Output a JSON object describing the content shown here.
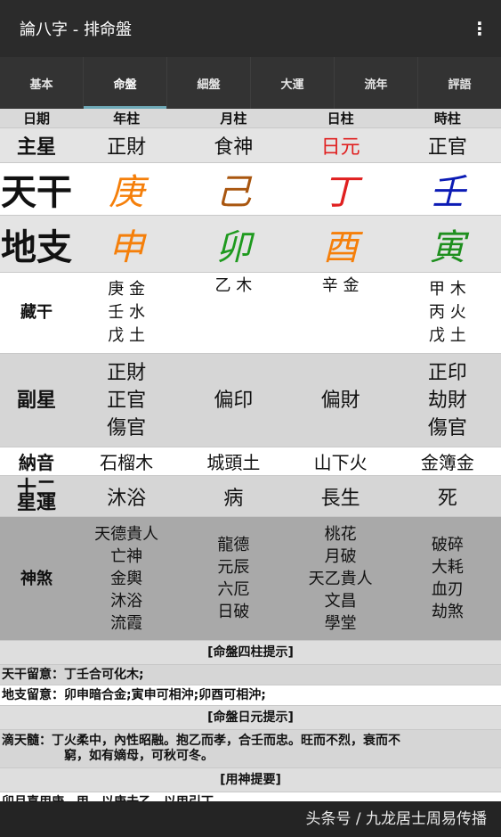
{
  "app": {
    "title": "論八字 - 排命盤",
    "menu_icon": "⋮"
  },
  "tabs": [
    {
      "label": "基本"
    },
    {
      "label": "命盤"
    },
    {
      "label": "細盤"
    },
    {
      "label": "大運"
    },
    {
      "label": "流年"
    },
    {
      "label": "評語"
    }
  ],
  "grid": {
    "header": [
      "日期",
      "年柱",
      "月柱",
      "日柱",
      "時柱"
    ],
    "main_star": {
      "label": "主星",
      "values": [
        "正財",
        "食神",
        "日元",
        "正官"
      ],
      "colors": [
        "#111111",
        "#111111",
        "#e02020",
        "#111111"
      ]
    },
    "tiangan": {
      "label": "天干",
      "values": [
        "庚",
        "己",
        "丁",
        "壬"
      ],
      "colors": [
        "#f57f0a",
        "#a9560f",
        "#e02020",
        "#0b1bb5"
      ]
    },
    "dizhi": {
      "label": "地支",
      "values": [
        "申",
        "卯",
        "酉",
        "寅"
      ],
      "colors": [
        "#f57f0a",
        "#1e9a1e",
        "#f57f0a",
        "#1e8f1e"
      ]
    },
    "canggan": {
      "label": "藏干",
      "values": [
        [
          "庚 金",
          "壬 水",
          "戊 土"
        ],
        [
          "乙 木"
        ],
        [
          "辛 金"
        ],
        [
          "甲 木",
          "丙 火",
          "戊 土"
        ]
      ]
    },
    "fuxing": {
      "label": "副星",
      "values": [
        [
          "正財",
          "正官",
          "傷官"
        ],
        [
          "偏印"
        ],
        [
          "偏財"
        ],
        [
          "正印",
          "劫財",
          "傷官"
        ]
      ]
    },
    "nayin": {
      "label": "納音",
      "values": [
        "石榴木",
        "城頭土",
        "山下火",
        "金簿金"
      ]
    },
    "shier": {
      "label_line1": "十二",
      "label_line2": "星運",
      "values": [
        "沐浴",
        "病",
        "長生",
        "死"
      ]
    },
    "shensha": {
      "label": "神煞",
      "values": [
        [
          "天德貴人",
          "亡神",
          "金輿",
          "沐浴",
          "流霞"
        ],
        [
          "龍德",
          "元辰",
          "六厄",
          "日破"
        ],
        [
          "桃花",
          "月破",
          "天乙貴人",
          "文昌",
          "學堂"
        ],
        [
          "破碎",
          "大耗",
          "血刃",
          "劫煞"
        ]
      ]
    }
  },
  "section1": {
    "title": "[命盤四柱提示]",
    "line1": "天干留意：丁壬合可化木;",
    "line2": "地支留意：卯申暗合金;寅申可相沖;卯酉可相沖;"
  },
  "section2": {
    "title": "[命盤日元提示]",
    "line1": "滴天髓：丁火柔中，內性昭融。抱乙而孝，合壬而忠。旺而不烈，衰而不",
    "line2": "窮，如有嫡母，可秋可冬。"
  },
  "section3": {
    "title": "[用神提要]",
    "line1": "卯月喜用庚，甲。以庚去乙，以甲引丁。"
  },
  "watermark": "头条号 / 九龙居士周易传播"
}
